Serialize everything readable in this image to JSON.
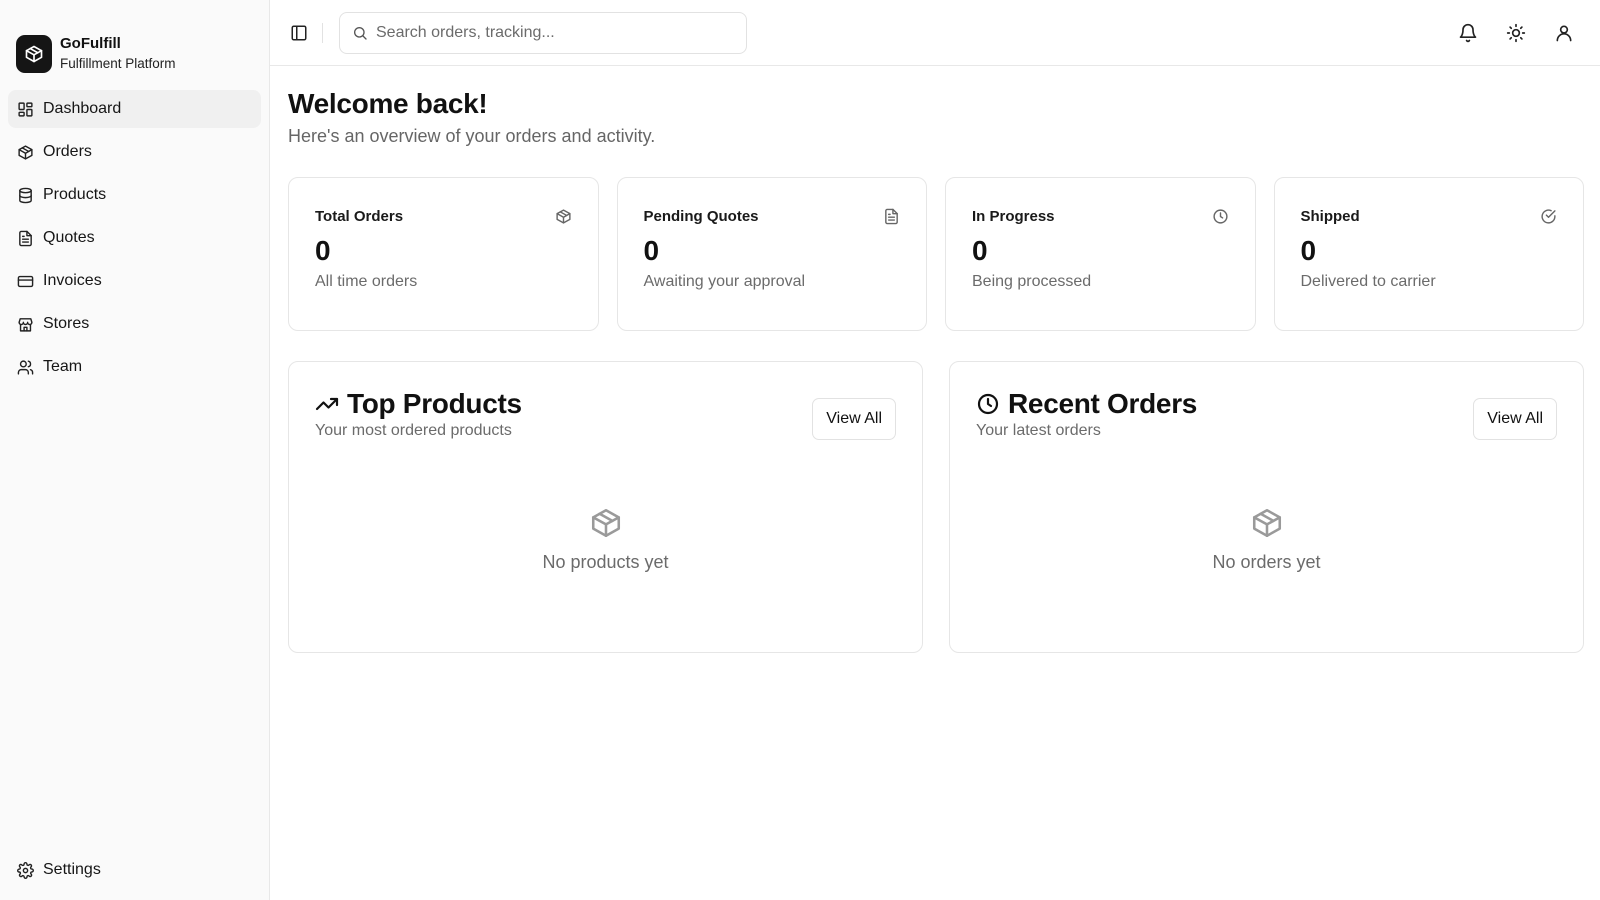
{
  "brand": {
    "name": "GoFulfill",
    "subtitle": "Fulfillment Platform",
    "icon": "package-icon"
  },
  "sidebar": {
    "items": [
      {
        "label": "Dashboard",
        "icon": "layout-grid-icon",
        "active": true
      },
      {
        "label": "Orders",
        "icon": "package-icon"
      },
      {
        "label": "Products",
        "icon": "database-icon"
      },
      {
        "label": "Quotes",
        "icon": "file-text-icon"
      },
      {
        "label": "Invoices",
        "icon": "credit-card-icon"
      },
      {
        "label": "Stores",
        "icon": "store-icon"
      },
      {
        "label": "Team",
        "icon": "users-icon"
      }
    ],
    "settings": {
      "label": "Settings",
      "icon": "gear-icon"
    }
  },
  "header": {
    "search_placeholder": "Search orders, tracking...",
    "icons": [
      "sidebar-toggle-icon",
      "search-icon",
      "bell-icon",
      "sun-icon",
      "user-icon"
    ]
  },
  "main": {
    "title": "Welcome back!",
    "subtitle": "Here's an overview of your orders and activity.",
    "stats": [
      {
        "label": "Total Orders",
        "value": "0",
        "description": "All time orders",
        "icon": "package-icon"
      },
      {
        "label": "Pending Quotes",
        "value": "0",
        "description": "Awaiting your approval",
        "icon": "file-text-icon"
      },
      {
        "label": "In Progress",
        "value": "0",
        "description": "Being processed",
        "icon": "clock-icon"
      },
      {
        "label": "Shipped",
        "value": "0",
        "description": "Delivered to carrier",
        "icon": "check-circle-icon"
      }
    ],
    "panels": {
      "top_products": {
        "title": "Top Products",
        "subtitle": "Your most ordered products",
        "button": "View All",
        "empty_text": "No products yet",
        "icon": "trending-up-icon"
      },
      "recent_orders": {
        "title": "Recent Orders",
        "subtitle": "Your latest orders",
        "button": "View All",
        "empty_text": "No orders yet",
        "icon": "clock-icon"
      }
    }
  },
  "colors": {
    "text": "#111111",
    "muted": "#6b6b6b",
    "border": "#e6e6e6",
    "sidebar_bg": "#fafafa",
    "active_bg": "#f0f0f0",
    "logo_bg": "#151515"
  }
}
